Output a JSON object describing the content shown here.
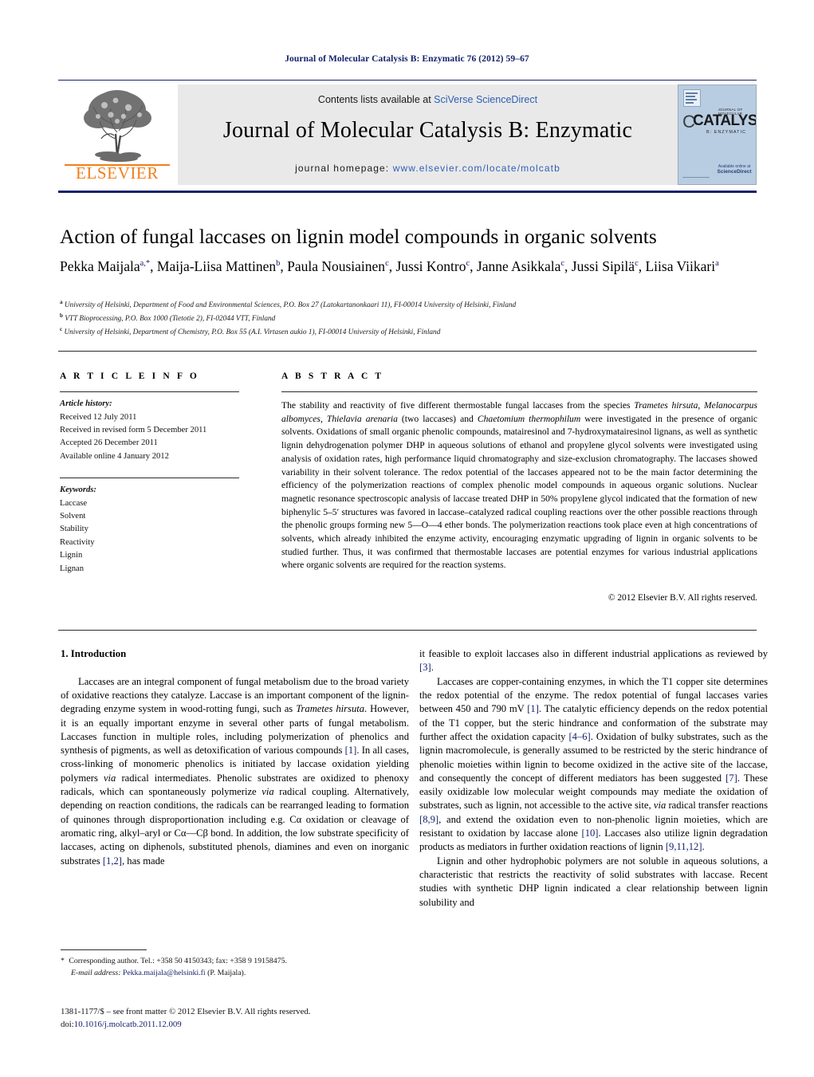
{
  "running_head": "Journal of Molecular Catalysis B: Enzymatic 76 (2012) 59–67",
  "masthead": {
    "publisher_name": "ELSEVIER",
    "contents_prefix": "Contents lists available at ",
    "contents_link": "SciVerse ScienceDirect",
    "journal_title": "Journal of Molecular Catalysis B: Enzymatic",
    "homepage_prefix": "journal homepage: ",
    "homepage_url": "www.elsevier.com/locate/molcatb",
    "cover": {
      "small_top": "JOURNAL OF MOLECULAR",
      "big": "CATALYSIS",
      "sub": "B: ENZYMATIC",
      "c_glyph": "C",
      "science_direct": "ScienceDirect",
      "available_online": "Available online at"
    }
  },
  "article": {
    "title": "Action of fungal laccases on lignin model compounds in organic solvents",
    "authors_html": "Pekka Maijala<sup>a,*</sup>, Maija-Liisa Mattinen<sup>b</sup>, Paula Nousiainen<sup>c</sup>, Jussi Kontro<sup>c</sup>, Janne Asikkala<sup>c</sup>, Jussi Sipilä<sup>c</sup>, Liisa Viikari<sup>a</sup>",
    "affiliations": [
      "University of Helsinki, Department of Food and Environmental Sciences, P.O. Box 27 (Latokartanonkaari 11), FI-00014 University of Helsinki, Finland",
      "VTT Bioprocessing, P.O. Box 1000 (Tietotie 2), FI-02044 VTT, Finland",
      "University of Helsinki, Department of Chemistry, P.O. Box 55 (A.I. Virtasen aukio 1), FI-00014 University of Helsinki, Finland"
    ],
    "affiliation_marks": [
      "a",
      "b",
      "c"
    ]
  },
  "article_info": {
    "heading": "A R T I C L E   I N F O",
    "history_label": "Article history:",
    "history": [
      "Received 12 July 2011",
      "Received in revised form 5 December 2011",
      "Accepted 26 December 2011",
      "Available online 4 January 2012"
    ],
    "keywords_label": "Keywords:",
    "keywords": [
      "Laccase",
      "Solvent",
      "Stability",
      "Reactivity",
      "Lignin",
      "Lignan"
    ]
  },
  "abstract": {
    "heading": "A B S T R A C T",
    "text_html": "The stability and reactivity of five different thermostable fungal laccases from the species <i>Trametes hirsuta</i>, <i>Melanocarpus albomyces</i>, <i>Thielavia arenaria</i> (two laccases) and <i>Chaetomium thermophilum</i> were investigated in the presence of organic solvents. Oxidations of small organic phenolic compounds, matairesinol and 7-hydroxymatairesinol lignans, as well as synthetic lignin dehydrogenation polymer DHP in aqueous solutions of ethanol and propylene glycol solvents were investigated using analysis of oxidation rates, high performance liquid chromatography and size-exclusion chromatography. The laccases showed variability in their solvent tolerance. The redox potential of the laccases appeared not to be the main factor determining the efficiency of the polymerization reactions of complex phenolic model compounds in aqueous organic solutions. Nuclear magnetic resonance spectroscopic analysis of laccase treated DHP in 50% propylene glycol indicated that the formation of new biphenylic 5–5&#8242; structures was favored in laccase–catalyzed radical coupling reactions over the other possible reactions through the phenolic groups forming new 5&#8212;O&#8212;4 ether bonds. The polymerization reactions took place even at high concentrations of solvents, which already inhibited the enzyme activity, encouraging enzymatic upgrading of lignin in organic solvents to be studied further. Thus, it was confirmed that thermostable laccases are potential enzymes for various industrial applications where organic solvents are required for the reaction systems.",
    "copyright": "© 2012 Elsevier B.V. All rights reserved."
  },
  "introduction": {
    "heading": "1.  Introduction",
    "left_paragraphs_html": [
      "Laccases are an integral component of fungal metabolism due to the broad variety of oxidative reactions they catalyze. Laccase is an important component of the lignin-degrading enzyme system in wood-rotting fungi, such as <i>Trametes hirsuta</i>. However, it is an equally important enzyme in several other parts of fungal metabolism. Laccases function in multiple roles, including polymerization of phenolics and synthesis of pigments, as well as detoxification of various compounds <span class=\"ref\">[1]</span>. In all cases, cross-linking of monomeric phenolics is initiated by laccase oxidation yielding polymers <i>via</i> radical intermediates. Phenolic substrates are oxidized to phenoxy radicals, which can spontaneously polymerize <i>via</i> radical coupling. Alternatively, depending on reaction conditions, the radicals can be rearranged leading to formation of quinones through disproportionation including e.g. C&#945; oxidation or cleavage of aromatic ring, alkyl–aryl or C&#945;&#8212;C&#946; bond. In addition, the low substrate specificity of laccases, acting on diphenols, substituted phenols, diamines and even on inorganic substrates <span class=\"ref\">[1,2]</span>, has made"
    ],
    "right_paragraphs_html": [
      "it feasible to exploit laccases also in different industrial applications as reviewed by <span class=\"ref\">[3]</span>.",
      "Laccases are copper-containing enzymes, in which the T1 copper site determines the redox potential of the enzyme. The redox potential of fungal laccases varies between 450 and 790 mV <span class=\"ref\">[1]</span>. The catalytic efficiency depends on the redox potential of the T1 copper, but the steric hindrance and conformation of the substrate may further affect the oxidation capacity <span class=\"ref\">[4–6]</span>. Oxidation of bulky substrates, such as the lignin macromolecule, is generally assumed to be restricted by the steric hindrance of phenolic moieties within lignin to become oxidized in the active site of the laccase, and consequently the concept of different mediators has been suggested <span class=\"ref\">[7]</span>. These easily oxidizable low molecular weight compounds may mediate the oxidation of substrates, such as lignin, not accessible to the active site, <i>via</i> radical transfer reactions <span class=\"ref\">[8,9]</span>, and extend the oxidation even to non-phenolic lignin moieties, which are resistant to oxidation by laccase alone <span class=\"ref\">[10]</span>. Laccases also utilize lignin degradation products as mediators in further oxidation reactions of lignin <span class=\"ref\">[9,11,12]</span>.",
      "Lignin and other hydrophobic polymers are not soluble in aqueous solutions, a characteristic that restricts the reactivity of solid substrates with laccase. Recent studies with synthetic DHP lignin indicated a clear relationship between lignin solubility and"
    ]
  },
  "footnotes": {
    "corresponding_html": "<span class=\"star\">*</span> Corresponding author. Tel.: +358 50 4150343; fax: +358 9 19158475.",
    "email_label": "E-mail address:",
    "email": "Pekka.maijala@helsinki.fi",
    "email_suffix": "(P. Maijala).",
    "issn_line": "1381-1177/$ – see front matter © 2012 Elsevier B.V. All rights reserved.",
    "doi_label": "doi:",
    "doi_value": "10.1016/j.molcatb.2011.12.009"
  },
  "colors": {
    "journal_blue": "#15216b",
    "link_blue": "#2f5fb5",
    "elsevier_orange": "#f07f1a",
    "banner_grey": "#e9e9e9",
    "cover_blue": "#b9cde2"
  }
}
